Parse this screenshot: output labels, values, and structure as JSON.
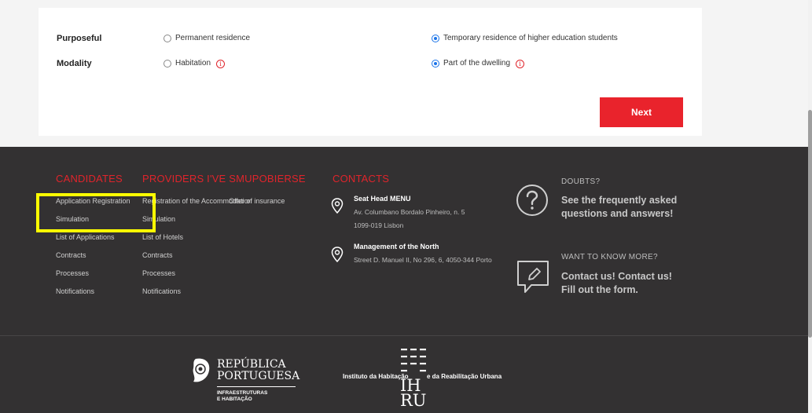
{
  "form": {
    "purposeful": {
      "label": "Purposeful",
      "options": [
        {
          "label": "Permanent residence",
          "selected": false
        },
        {
          "label": "Temporary residence of higher education students",
          "selected": true
        }
      ]
    },
    "modality": {
      "label": "Modality",
      "options": [
        {
          "label": "Habitation",
          "selected": false
        },
        {
          "label": "Part of the dwelling",
          "selected": true
        }
      ]
    },
    "info_glyph": "i",
    "next_label": "Next"
  },
  "footer": {
    "candidates": {
      "title": "CANDIDATES",
      "links": [
        "Application Registration",
        "Simulation",
        "List of Applications",
        "Contracts",
        "Processes",
        "Notifications"
      ]
    },
    "providers": {
      "title": "PROVIDERS I'VE SMUPOBIERSE",
      "links": [
        "Registration of the Accommodation",
        "Simulation",
        "List of Hotels",
        "Contracts",
        "Processes",
        "Notifications"
      ],
      "extra_link": "Offer of insurance"
    },
    "contacts": {
      "title": "CONTACTS",
      "head": {
        "title": "Seat Head MENU",
        "line1": "Av. Columbano Bordalo Pinheiro, n. 5",
        "line2": "1099-019 Lisbon"
      },
      "north": {
        "title": "Management of the North",
        "line1": "Street D. Manuel II, No 296, 6, 4050-344 Porto"
      }
    },
    "doubts": {
      "label": "DOUBTS?",
      "line1": "See the frequently asked",
      "line2": "questions and answers!"
    },
    "more": {
      "label": "WANT TO KNOW MORE?",
      "line1": "Contact us! Contact us!",
      "line2": "Fill out the form."
    },
    "logos": {
      "republica_line1": "REPÚBLICA",
      "republica_line2": "PORTUGUESA",
      "republica_sub1": "INFRAESTRUTURAS",
      "republica_sub2": "E HABITAÇÃO",
      "ihru_left": "Instituto da Habitação",
      "ihru_right": "e da Reabilitação Urbana",
      "ihru_mark_top": "IH",
      "ihru_mark_bottom": "RU"
    }
  },
  "colors": {
    "accent": "#e9232c",
    "footer_bg": "#333132",
    "radio_selected": "#1a73e8",
    "highlight": "#ffff00"
  }
}
